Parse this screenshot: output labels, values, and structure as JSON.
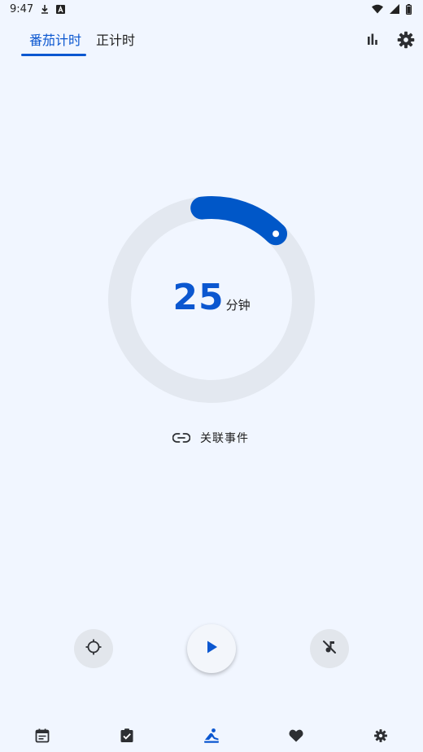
{
  "status_bar": {
    "time": "9:47",
    "icons": [
      "download-icon",
      "font-a-icon",
      "wifi-icon",
      "signal-icon",
      "battery-icon"
    ]
  },
  "tabs": [
    {
      "label": "番茄计时",
      "selected": true
    },
    {
      "label": "正计时",
      "selected": false
    }
  ],
  "toolbar_icons": [
    "bar-chart-icon",
    "gear-icon"
  ],
  "timer": {
    "value": "25",
    "unit": "分钟",
    "progress": 0.14
  },
  "link_event": {
    "label": "关联事件",
    "icon": "link-icon"
  },
  "controls": {
    "left_icon": "crosshair-icon",
    "center_icon": "play-icon",
    "right_icon": "music-off-icon"
  },
  "bottom_nav": [
    {
      "icon": "calendar-icon",
      "active": false
    },
    {
      "icon": "task-check-icon",
      "active": false
    },
    {
      "icon": "focus-person-icon",
      "active": true
    },
    {
      "icon": "heart-icon",
      "active": false
    },
    {
      "icon": "gear-icon",
      "active": false
    }
  ],
  "colors": {
    "background": "#f1f6ff",
    "accent": "#0b57d0",
    "ring_track": "#e3e8f0",
    "ring_progress": "#0057c8",
    "icon_dark": "#2d2f33"
  }
}
